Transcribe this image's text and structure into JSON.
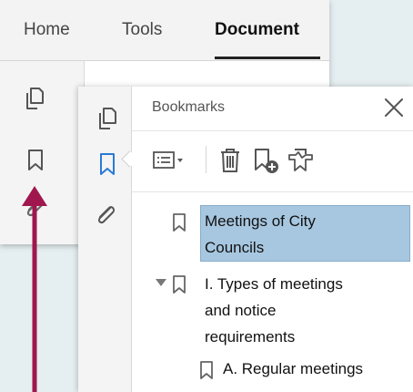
{
  "tabs": {
    "home": "Home",
    "tools": "Tools",
    "document": "Document",
    "active": "document"
  },
  "panel": {
    "title": "Bookmarks"
  },
  "bookmarks": [
    {
      "label_lines": [
        "Meetings of City",
        "Councils"
      ],
      "selected": true,
      "expandable": false
    },
    {
      "label_lines": [
        "I. Types of meetings",
        "and notice",
        "requirements"
      ],
      "selected": false,
      "expandable": true,
      "expanded": true
    },
    {
      "label_lines": [
        "A. Regular meetings"
      ],
      "selected": false,
      "expandable": false
    }
  ],
  "colors": {
    "accent_blue": "#2a7ad6",
    "selection_bg": "#a7c7e0",
    "annotation_arrow": "#a0174e"
  },
  "icons": {
    "rail": [
      "pages-icon",
      "bookmark-icon",
      "paperclip-icon"
    ],
    "toolbar": [
      "options-menu-icon",
      "trash-icon",
      "new-bookmark-icon",
      "tag-bookmark-icon"
    ]
  }
}
